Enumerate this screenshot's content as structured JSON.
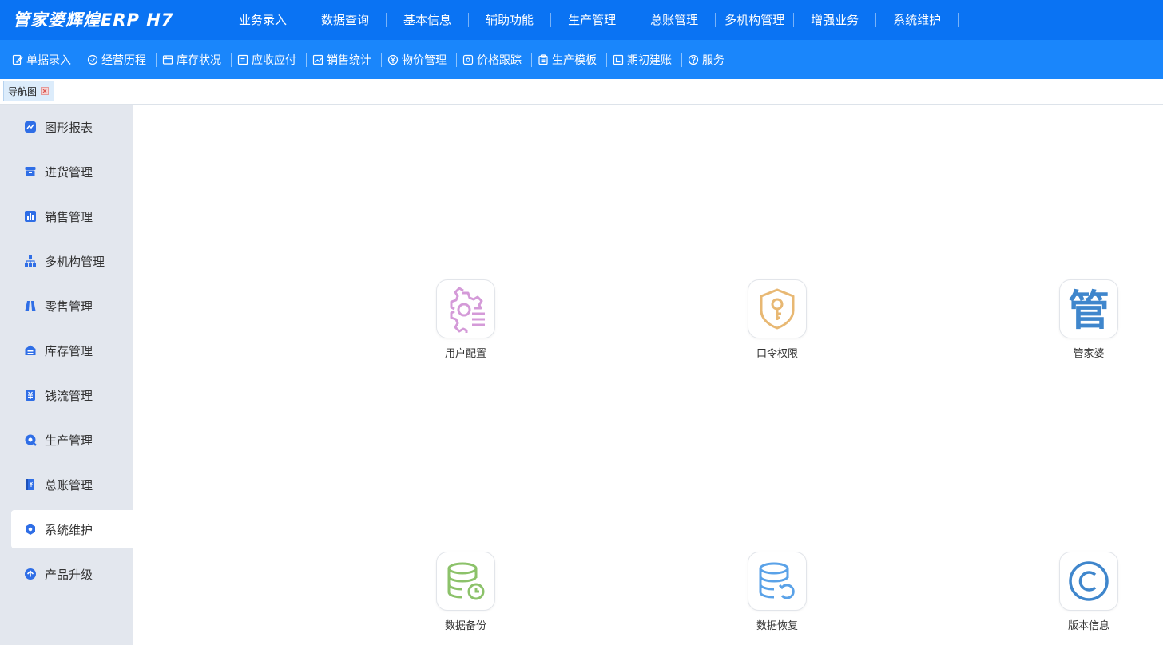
{
  "app": {
    "brand": "管家婆辉煌ERP H7"
  },
  "main_menu": [
    {
      "label": "业务录入"
    },
    {
      "label": "数据查询"
    },
    {
      "label": "基本信息"
    },
    {
      "label": "辅助功能"
    },
    {
      "label": "生产管理"
    },
    {
      "label": "总账管理"
    },
    {
      "label": "多机构管理"
    },
    {
      "label": "增强业务"
    },
    {
      "label": "系统维护"
    }
  ],
  "toolbar": [
    {
      "label": "单据录入",
      "icon": "edit-doc-icon"
    },
    {
      "label": "经营历程",
      "icon": "history-icon"
    },
    {
      "label": "库存状况",
      "icon": "inventory-icon"
    },
    {
      "label": "应收应付",
      "icon": "receivable-icon"
    },
    {
      "label": "销售统计",
      "icon": "sales-chart-icon"
    },
    {
      "label": "物价管理",
      "icon": "price-icon"
    },
    {
      "label": "价格跟踪",
      "icon": "price-track-icon"
    },
    {
      "label": "生产模板",
      "icon": "template-icon"
    },
    {
      "label": "期初建账",
      "icon": "opening-account-icon"
    },
    {
      "label": "服务",
      "icon": "help-icon"
    }
  ],
  "tabs": [
    {
      "label": "导航图"
    }
  ],
  "sidebar": {
    "items": [
      {
        "label": "图形报表",
        "icon": "chart-icon"
      },
      {
        "label": "进货管理",
        "icon": "purchase-icon"
      },
      {
        "label": "销售管理",
        "icon": "sales-icon"
      },
      {
        "label": "多机构管理",
        "icon": "org-icon"
      },
      {
        "label": "零售管理",
        "icon": "retail-icon"
      },
      {
        "label": "库存管理",
        "icon": "stock-icon"
      },
      {
        "label": "钱流管理",
        "icon": "cashflow-icon"
      },
      {
        "label": "生产管理",
        "icon": "production-icon"
      },
      {
        "label": "总账管理",
        "icon": "ledger-icon"
      },
      {
        "label": "系统维护",
        "icon": "system-icon",
        "active": true
      },
      {
        "label": "产品升级",
        "icon": "upgrade-icon"
      }
    ]
  },
  "tiles": [
    {
      "label": "用户配置",
      "icon": "user-config-icon",
      "color": "#d49ad8"
    },
    {
      "label": "口令权限",
      "icon": "password-permission-icon",
      "color": "#e8b873"
    },
    {
      "label": "管家婆",
      "icon": "brand-logo-icon",
      "color": "#3f86cc"
    },
    {
      "label": "数据备份",
      "icon": "data-backup-icon",
      "color": "#8cc26a"
    },
    {
      "label": "数据恢复",
      "icon": "data-restore-icon",
      "color": "#5aa2e8"
    },
    {
      "label": "版本信息",
      "icon": "copyright-icon",
      "color": "#3f86cc"
    }
  ],
  "logo_glyph": "管"
}
